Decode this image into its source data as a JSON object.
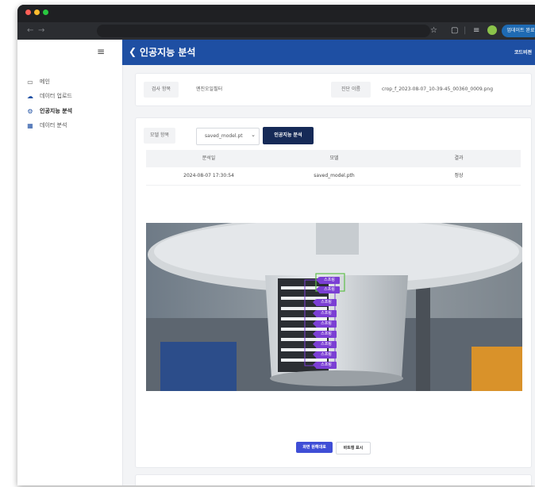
{
  "window": {
    "colors": {
      "close": "#ff5f57",
      "minimize": "#febc2e",
      "zoom": "#28c840"
    }
  },
  "browser": {
    "back_icon": "←",
    "forward_icon": "→",
    "star_icon": "☆",
    "tab_icon": "▢",
    "divider": "|",
    "extension_icon": "≡",
    "update_label": "업데이트 완료"
  },
  "sidebar": {
    "menu_icon": "≡",
    "items": [
      {
        "label": "메인",
        "icon": "monitor-icon",
        "glyph": "▭",
        "active": false
      },
      {
        "label": "데이터 업로드",
        "icon": "cloud-upload-icon",
        "glyph": "☁",
        "active": false
      },
      {
        "label": "인공지능 분석",
        "icon": "gear-icon",
        "glyph": "⚙",
        "active": true
      },
      {
        "label": "데이터 분석",
        "icon": "chart-icon",
        "glyph": "▦",
        "active": false
      }
    ]
  },
  "header": {
    "back_icon": "❮",
    "title": "인공지능 분석",
    "brand": "코드비젼"
  },
  "inspection": {
    "item_label": "검사 항목",
    "item_value": "엔진오일필터",
    "image_label": "진단 이름",
    "image_value": "crop_f_2023-08-07_10-39-45_00360_0009.png"
  },
  "analysis": {
    "model_label": "모델 항목",
    "model_selected": "saved_model.pt",
    "chevron": "⌄",
    "run_button": "인공지능 분석"
  },
  "table": {
    "headers": [
      "분석일",
      "모델",
      "결과"
    ],
    "rows": [
      [
        "2024-08-07 17:30:54",
        "saved_model.pth",
        "정상"
      ]
    ]
  },
  "detections": {
    "label": "스프링",
    "count": 9,
    "color": "#7b3fd4"
  },
  "view_toggle": {
    "full_screen": "화면 원해대로",
    "bbox": "바트렝 표시"
  },
  "colors": {
    "accent": "#1e4fa3",
    "dark_button": "#162a57"
  }
}
